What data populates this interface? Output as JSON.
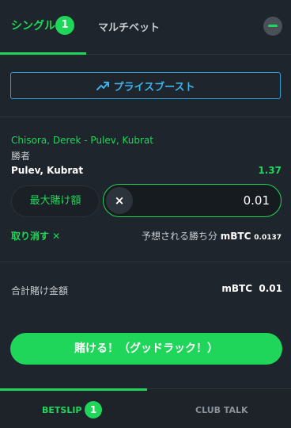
{
  "tabs": {
    "single": {
      "label": "シングル",
      "count": "1"
    },
    "multi": {
      "label": "マルチベット"
    }
  },
  "boost": {
    "label": "プライスブースト",
    "icon": "trend-up-icon"
  },
  "bet": {
    "event": "Chisora, Derek - Pulev, Kubrat",
    "market": "勝者",
    "selection": "Pulev, Kubrat",
    "odds": "1.37",
    "max_bet_label": "最大賭け額",
    "clear_icon": "×",
    "stake_value": "0.01",
    "remove_label": "取り消す ✕",
    "winnings_label": "予想される勝ち分",
    "winnings_currency": "mBTC",
    "winnings_amount": "0.0137"
  },
  "total": {
    "label": "合計賭け金額",
    "value": "mBTC  0.01"
  },
  "place_bet_label": "賭ける！（グッドラック！）",
  "bottom_nav": {
    "betslip_label": "BETSLIP",
    "betslip_count": "1",
    "club_label": "CLUB TALK"
  },
  "colors": {
    "accent": "#1fd65a",
    "boost": "#3ab3ec",
    "background": "#1f252c"
  }
}
